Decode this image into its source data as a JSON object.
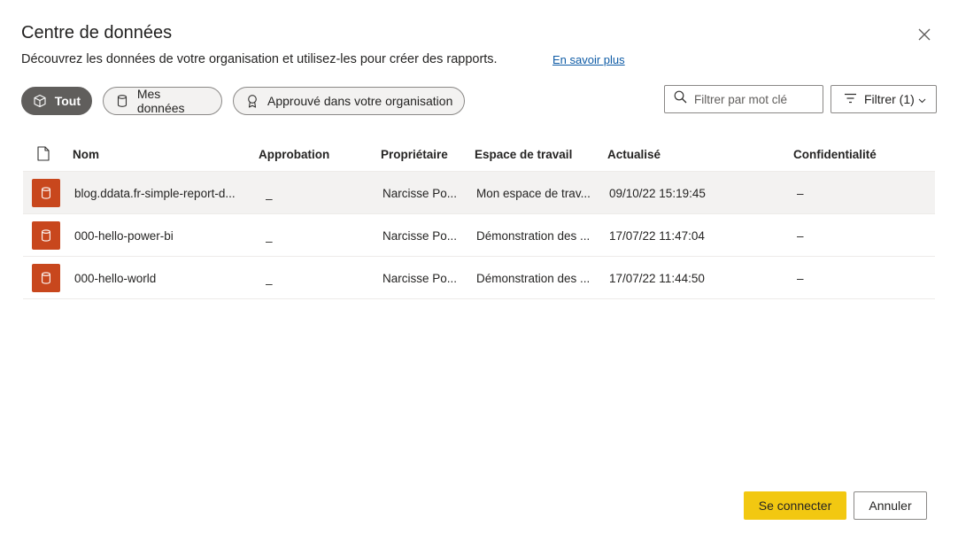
{
  "dialog": {
    "title": "Centre de données",
    "subtitle": "Découvrez les données de votre organisation et utilisez-les pour créer des rapports.",
    "learn_more": "En savoir plus"
  },
  "pills": {
    "all": "Tout",
    "mine": "Mes données",
    "approved": "Approuvé dans votre organisation"
  },
  "search": {
    "placeholder": "Filtrer par mot clé"
  },
  "filter": {
    "label": "Filtrer (1)"
  },
  "table": {
    "headers": {
      "name": "Nom",
      "approval": "Approbation",
      "owner": "Propriétaire",
      "workspace": "Espace de travail",
      "updated": "Actualisé",
      "sensitivity": "Confidentialité"
    },
    "rows": [
      {
        "name": "blog.ddata.fr-simple-report-d...",
        "approval": "_",
        "owner": "Narcisse Po...",
        "workspace": "Mon espace de trav...",
        "updated": "09/10/22 15:19:45",
        "sensitivity": "–"
      },
      {
        "name": "000-hello-power-bi",
        "approval": "_",
        "owner": "Narcisse Po...",
        "workspace": "Démonstration des ...",
        "updated": "17/07/22 11:47:04",
        "sensitivity": "–"
      },
      {
        "name": "000-hello-world",
        "approval": "_",
        "owner": "Narcisse Po...",
        "workspace": "Démonstration des ...",
        "updated": "17/07/22 11:44:50",
        "sensitivity": "–"
      }
    ]
  },
  "footer": {
    "connect": "Se connecter",
    "cancel": "Annuler"
  },
  "colors": {
    "accent": "#f2c811",
    "dataset_badge": "#c8471d",
    "link": "#0f5ca6",
    "active_pill": "#605e5c"
  }
}
